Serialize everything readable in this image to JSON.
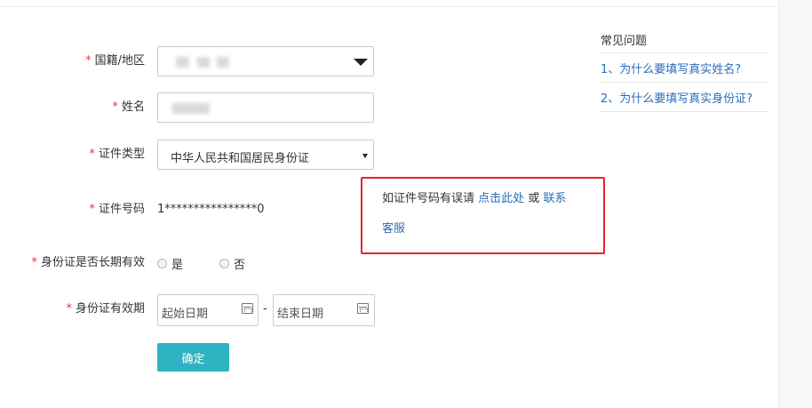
{
  "form": {
    "required_mark": "*",
    "nationality": {
      "label": "国籍/地区"
    },
    "name": {
      "label": "姓名"
    },
    "id_type": {
      "label": "证件类型",
      "selected": "中华人民共和国居民身份证"
    },
    "id_number": {
      "label": "证件号码",
      "value": "1****************0"
    },
    "long_term": {
      "label": "身份证是否长期有效",
      "options": [
        "是",
        "否"
      ]
    },
    "validity": {
      "label": "身份证有效期",
      "start_placeholder": "起始日期",
      "end_placeholder": "结束日期",
      "separator": "-"
    },
    "confirm_label": "确定"
  },
  "notice": {
    "text_before": "如证件号码有误请",
    "link1": "点击此处",
    "middle": "或",
    "link2_part1": "联系",
    "link2_part2": "客服"
  },
  "faq": {
    "title": "常见问题",
    "items": [
      "1、为什么要填写真实姓名?",
      "2、为什么要填写真实身份证?"
    ]
  },
  "colors": {
    "required": "#e4393c",
    "link": "#2a6ebb",
    "button": "#2fb2c2",
    "highlight_border": "#e5252a"
  }
}
